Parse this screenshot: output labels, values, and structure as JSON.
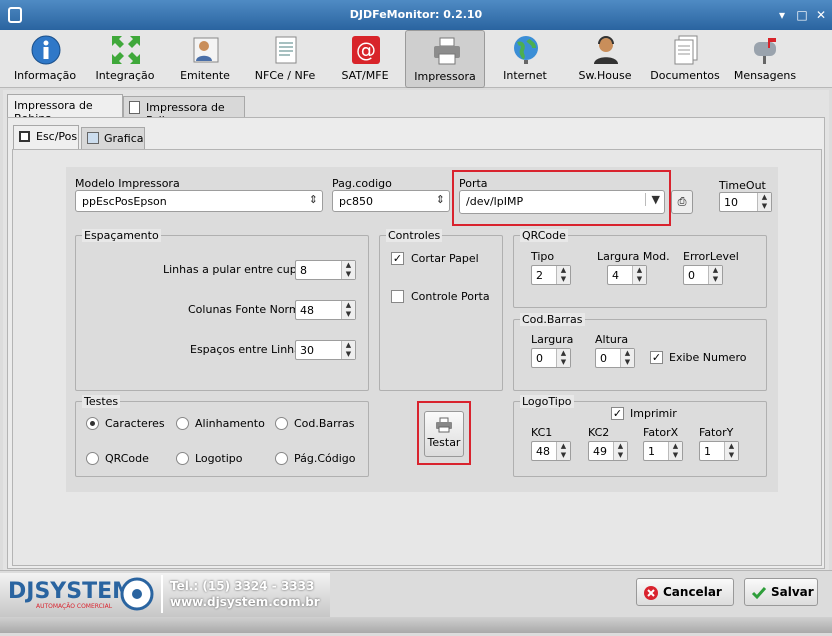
{
  "window": {
    "title": "DJDFeMonitor: 0.2.10",
    "minimize": "▾",
    "maximize": "□",
    "close": "✕"
  },
  "toolbar": [
    {
      "name": "informacao",
      "label": "Informação",
      "icon": "info-icon"
    },
    {
      "name": "integracao",
      "label": "Integração",
      "icon": "arrows-icon"
    },
    {
      "name": "emitente",
      "label": "Emitente",
      "icon": "person-card-icon"
    },
    {
      "name": "nfce-nfe",
      "label": "NFCe / NFe",
      "icon": "document-icon"
    },
    {
      "name": "sat-mfe",
      "label": "SAT/MFE",
      "icon": "at-sign-icon"
    },
    {
      "name": "impressora",
      "label": "Impressora",
      "icon": "printer-icon",
      "active": true
    },
    {
      "name": "internet",
      "label": "Internet",
      "icon": "globe-icon"
    },
    {
      "name": "swhouse",
      "label": "Sw.House",
      "icon": "support-person-icon"
    },
    {
      "name": "documentos",
      "label": "Documentos",
      "icon": "documents-icon"
    },
    {
      "name": "mensagens",
      "label": "Mensagens",
      "icon": "mailbox-icon"
    }
  ],
  "tabs_outer": [
    "Impressora de Bobina",
    "Impressora de Folha"
  ],
  "tabs_inner": [
    "Esc/Pos",
    "Grafica"
  ],
  "form": {
    "modelo_label": "Modelo Impressora",
    "modelo_value": "ppEscPosEpson",
    "pagcodigo_label": "Pag.codigo",
    "pagcodigo_value": "pc850",
    "porta_label": "Porta",
    "porta_value": "/dev/lpIMP",
    "timeout_label": "TimeOut",
    "timeout_value": "10"
  },
  "espacamento": {
    "title": "Espaçamento",
    "linhas_label": "Linhas a pular entre cupons:",
    "linhas_value": "8",
    "colunas_label": "Colunas Fonte Normal:",
    "colunas_value": "48",
    "espacos_label": "Espaços entre Linhas:",
    "espacos_value": "30"
  },
  "controles": {
    "title": "Controles",
    "cortar_label": "Cortar Papel",
    "cortar_checked": true,
    "controle_porta_label": "Controle Porta",
    "controle_porta_checked": false
  },
  "qrcode": {
    "title": "QRCode",
    "tipo_label": "Tipo",
    "tipo_value": "2",
    "largura_label": "Largura Mod.",
    "largura_value": "4",
    "error_label": "ErrorLevel",
    "error_value": "0"
  },
  "codbarras": {
    "title": "Cod.Barras",
    "largura_label": "Largura",
    "largura_value": "0",
    "altura_label": "Altura",
    "altura_value": "0",
    "exibe_label": "Exibe Numero",
    "exibe_checked": true
  },
  "logotipo": {
    "title": "LogoTipo",
    "imprimir_label": "Imprimir",
    "imprimir_checked": true,
    "kc1_label": "KC1",
    "kc1_value": "48",
    "kc2_label": "KC2",
    "kc2_value": "49",
    "fatorx_label": "FatorX",
    "fatorx_value": "1",
    "fatory_label": "FatorY",
    "fatory_value": "1"
  },
  "testes": {
    "title": "Testes",
    "options": [
      "Caracteres",
      "Alinhamento",
      "Cod.Barras",
      "QRCode",
      "Logotipo",
      "Pág.Código"
    ],
    "selected": "Caracteres",
    "testar_label": "Testar"
  },
  "footer": {
    "brand": "DJSYSTEM",
    "brand_sub": "AUTOMAÇÃO COMERCIAL",
    "tel": "Tel.: (15) 3324 - 3333",
    "site": "www.djsystem.com.br",
    "cancelar": "Cancelar",
    "salvar": "Salvar"
  },
  "colors": {
    "accent": "#2a64a0",
    "highlight": "#d9232e"
  }
}
